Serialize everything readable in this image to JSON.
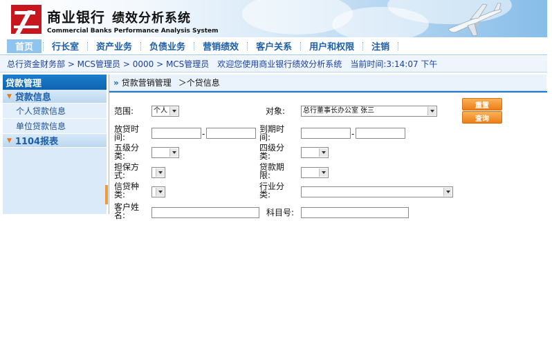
{
  "brand": {
    "name_cn": "商业银行",
    "system_cn": "绩效分析系统",
    "name_en": "Commercial Banks  Performance Analysis System"
  },
  "nav": {
    "items": [
      {
        "label": "首页",
        "active": true
      },
      {
        "label": "行长室"
      },
      {
        "label": "资产业务"
      },
      {
        "label": "负债业务"
      },
      {
        "label": "营销绩效"
      },
      {
        "label": "客户关系"
      },
      {
        "label": "用户和权限"
      },
      {
        "label": "注销"
      }
    ]
  },
  "infobar": {
    "path": "总行资金财务部 > MCS管理员 > 0000 > MCS管理员",
    "welcome": "欢迎您使用商业银行绩效分析系统",
    "time": "当前时间:3:14:07 下午"
  },
  "sidebar": {
    "title": "贷款管理",
    "groups": [
      {
        "label": "贷款信息",
        "items": [
          "个人贷款信息",
          "单位贷款信息"
        ]
      },
      {
        "label": "1104报表",
        "items": []
      }
    ]
  },
  "main": {
    "breadcrumb_1": "贷款营销管理",
    "breadcrumb_2": "＞个贷信息"
  },
  "form": {
    "scope_label": "范围:",
    "scope_value": "个人",
    "object_label": "对象:",
    "object_value": "总行董事长办公室  张三",
    "loan_time_label_1": "放贷时",
    "loan_time_label_2": "间:",
    "due_time_label_1": "到期时",
    "due_time_label_2": "间:",
    "five_class_label_1": "五级分",
    "five_class_label_2": "类:",
    "four_class_label_1": "四级分",
    "four_class_label_2": "类:",
    "guarantee_label_1": "担保方",
    "guarantee_label_2": "式:",
    "term_label_1": "贷款期",
    "term_label_2": "限:",
    "credit_type_label_1": "信贷种",
    "credit_type_label_2": "类:",
    "industry_label_1": "行业分",
    "industry_label_2": "类:",
    "customer_label_1": "客户姓",
    "customer_label_2": "名:",
    "subject_label": "科目号:",
    "range_sep": "-"
  },
  "buttons": {
    "reset": "重置",
    "query": "查询"
  },
  "colors": {
    "brand_red": "#c8161e",
    "nav_text": "#1c5fa8",
    "accent_orange": "#ec7d18",
    "sidebar_blue": "#0f63b0"
  }
}
